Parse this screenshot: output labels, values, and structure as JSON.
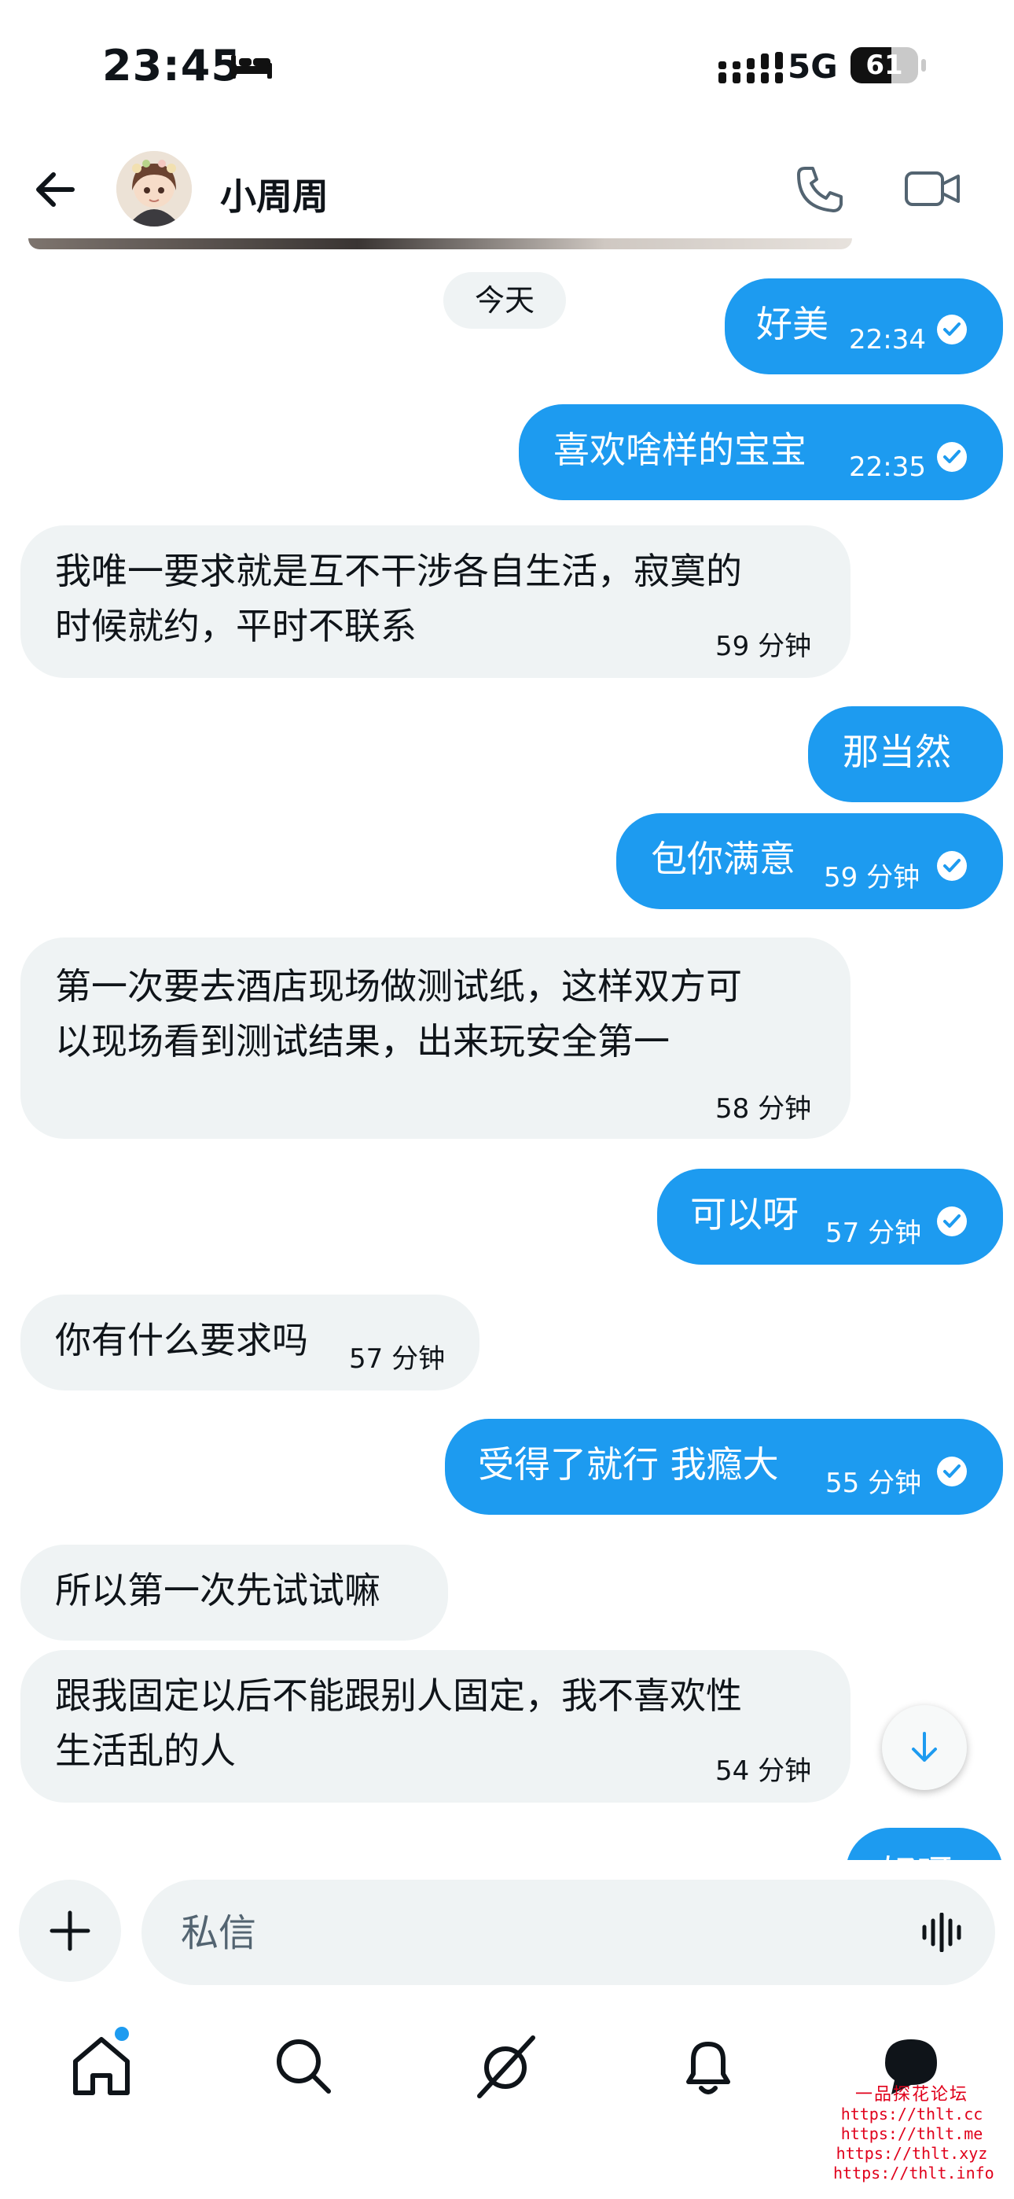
{
  "status_bar": {
    "time": "23:45",
    "network": "5G",
    "battery": "61",
    "battery_level": 0.61
  },
  "header": {
    "contact_name": "小周周"
  },
  "chat": {
    "day_separator": "今天",
    "messages": [
      {
        "dir": "out",
        "text": "好美",
        "time": "22:34",
        "read": true
      },
      {
        "dir": "out",
        "text": "喜欢啥样的宝宝",
        "time": "22:35",
        "read": true
      },
      {
        "dir": "in",
        "lines": [
          "我唯一要求就是互不干涉各自生活，寂寞的",
          "时候就约，平时不联系"
        ],
        "time": "59 分钟"
      },
      {
        "dir": "out",
        "text": "那当然",
        "time": ""
      },
      {
        "dir": "out",
        "text": "包你满意",
        "time": "59 分钟",
        "read": true
      },
      {
        "dir": "in",
        "lines": [
          "第一次要去酒店现场做测试纸，这样双方可",
          "以现场看到测试结果，出来玩安全第一"
        ],
        "time": "58 分钟"
      },
      {
        "dir": "out",
        "text": "可以呀",
        "time": "57 分钟",
        "read": true
      },
      {
        "dir": "in",
        "text": "你有什么要求吗",
        "time": "57 分钟"
      },
      {
        "dir": "out",
        "text": "受得了就行 我瘾大",
        "time": "55 分钟",
        "read": true
      },
      {
        "dir": "in",
        "text": "所以第一次先试试嘛",
        "time": ""
      },
      {
        "dir": "in",
        "lines": [
          "跟我固定以后不能跟别人固定，我不喜欢性",
          "生活乱的人"
        ],
        "time": "54 分钟"
      },
      {
        "dir": "out",
        "text": "好呀",
        "time": ""
      }
    ]
  },
  "composer": {
    "placeholder": "私信"
  },
  "watermark": {
    "title": "一品探花论坛",
    "urls": [
      "https://thlt.cc",
      "https://thlt.me",
      "https://thlt.xyz",
      "https://thlt.info"
    ]
  },
  "icons": [
    "bed-icon",
    "signal-icon",
    "back-arrow-icon",
    "phone-icon",
    "video-icon",
    "checkmark-icon",
    "arrow-down-icon",
    "plus-icon",
    "voice-wave-icon",
    "home-icon",
    "search-icon",
    "grok-icon",
    "bell-icon",
    "chat-icon"
  ],
  "colors": {
    "accent": "#1d9bf0",
    "incoming_bubble": "#eff3f4",
    "text": "#0f1419",
    "watermark": "#e0001b"
  }
}
